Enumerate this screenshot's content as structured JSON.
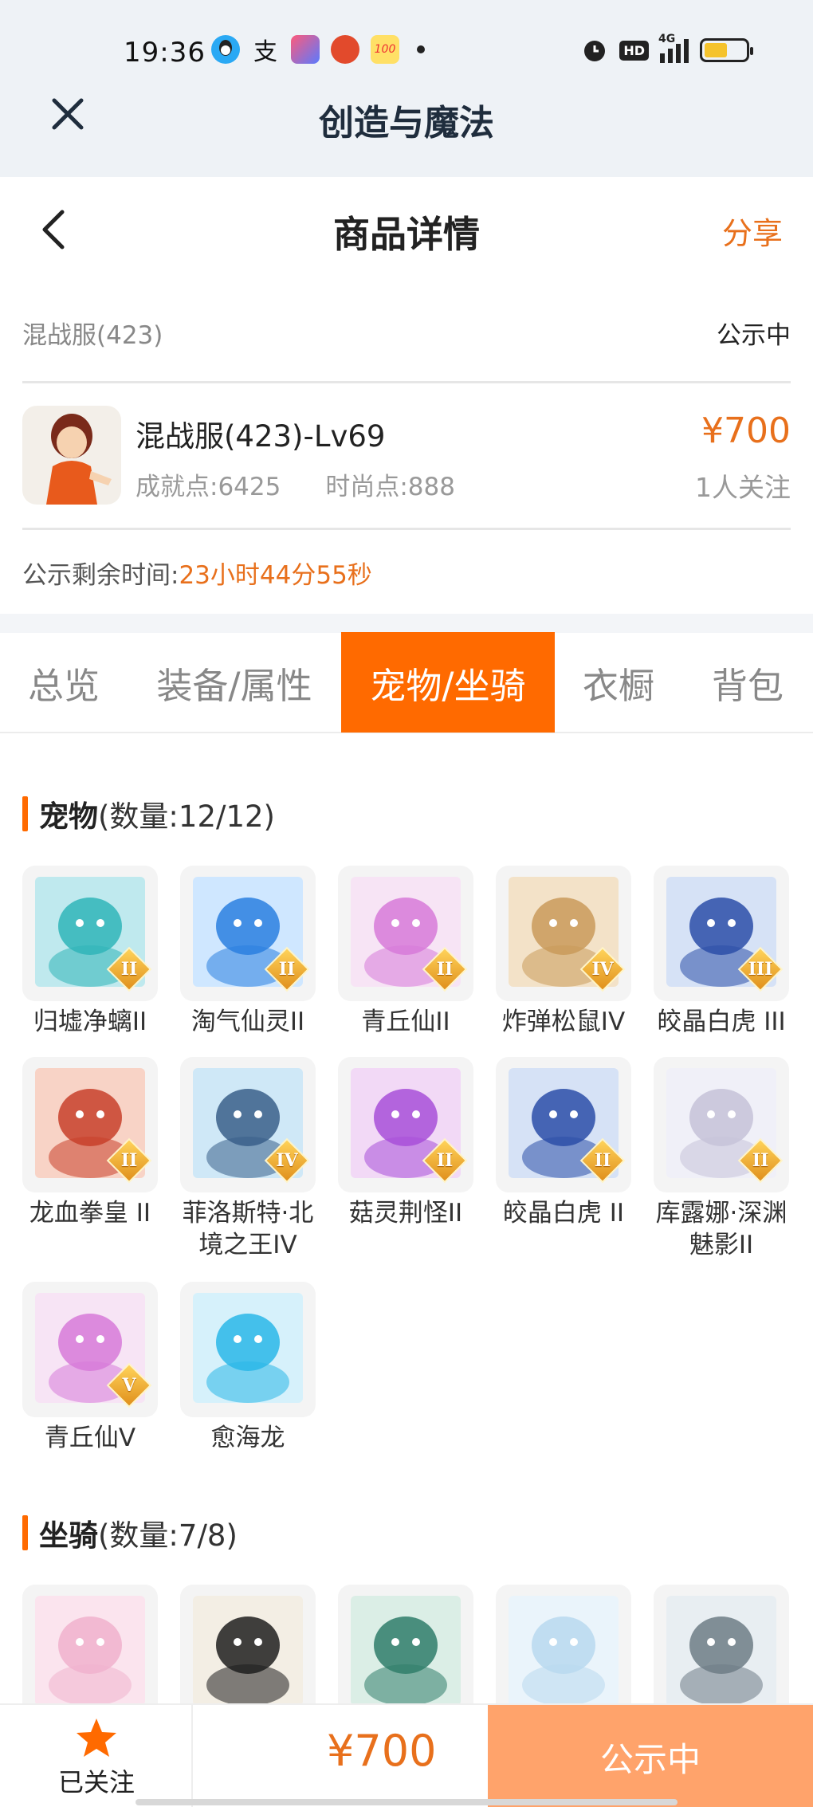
{
  "status_bar": {
    "time": "19:36",
    "network": "4G",
    "hd": "HD"
  },
  "app_bar": {
    "title": "创造与魔法"
  },
  "header": {
    "title": "商品详情",
    "share": "分享"
  },
  "server": {
    "name": "混战服(423)",
    "status": "公示中"
  },
  "character": {
    "name": "混战服(423)-Lv69",
    "achievement": "成就点:6425",
    "fashion": "时尚点:888",
    "price": "¥700",
    "followers": "1人关注"
  },
  "countdown": {
    "label": "公示剩余时间:",
    "value": "23小时44分55秒"
  },
  "tabs": [
    {
      "label": "总览",
      "active": false
    },
    {
      "label": "装备/属性",
      "active": false
    },
    {
      "label": "宠物/坐骑",
      "active": true
    },
    {
      "label": "衣橱",
      "active": false
    },
    {
      "label": "背包",
      "active": false
    }
  ],
  "pets": {
    "title": "宠物",
    "count": "(数量:12/12)",
    "items": [
      {
        "name": "归墟净螭II",
        "grade": "II",
        "icon": "dragon-icon"
      },
      {
        "name": "淘气仙灵II",
        "grade": "II",
        "icon": "blue-pup-icon"
      },
      {
        "name": "青丘仙II",
        "grade": "II",
        "icon": "fox-maiden-icon"
      },
      {
        "name": "炸弹松鼠IV",
        "grade": "IV",
        "icon": "squirrel-icon"
      },
      {
        "name": "皎晶白虎 III",
        "grade": "III",
        "icon": "white-tiger-icon"
      },
      {
        "name": "龙血拳皇 II",
        "grade": "II",
        "icon": "red-beast-icon"
      },
      {
        "name": "菲洛斯特·北境之王IV",
        "grade": "IV",
        "icon": "frost-king-icon"
      },
      {
        "name": "菇灵荆怪II",
        "grade": "II",
        "icon": "mushroom-sprite-icon"
      },
      {
        "name": "皎晶白虎 II",
        "grade": "II",
        "icon": "white-tiger-icon"
      },
      {
        "name": "库露娜·深渊魅影II",
        "grade": "II",
        "icon": "abyss-maiden-icon"
      },
      {
        "name": "青丘仙V",
        "grade": "V",
        "icon": "fox-maiden-icon"
      },
      {
        "name": "愈海龙",
        "grade": "",
        "icon": "sea-dragon-icon"
      }
    ]
  },
  "mounts": {
    "title": "坐骑",
    "count": "(数量:7/8)",
    "items": [
      {
        "icon": "pink-axolotl-icon"
      },
      {
        "icon": "black-pig-icon"
      },
      {
        "icon": "green-dragon-icon"
      },
      {
        "icon": "white-qilin-icon"
      },
      {
        "icon": "shark-icon"
      }
    ]
  },
  "bottom_bar": {
    "follow_label": "已关注",
    "price": "¥700",
    "action": "公示中"
  },
  "colors": {
    "accent": "#ff6a00",
    "price": "#e8701c",
    "buy_button": "#ffa36b"
  }
}
